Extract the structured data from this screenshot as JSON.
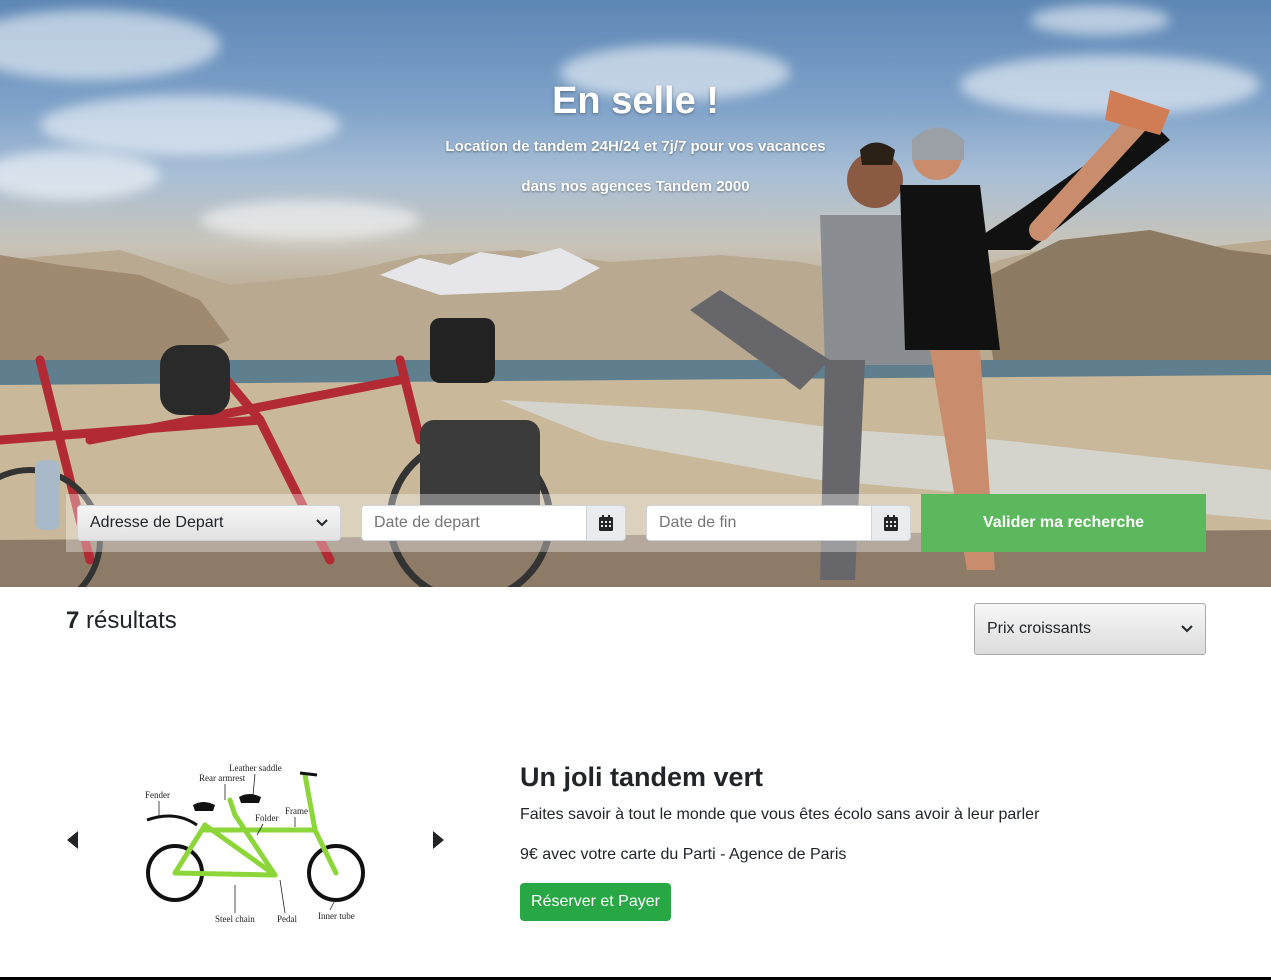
{
  "hero": {
    "title": "En selle !",
    "subtitle_line1": "Location de tandem 24H/24 et 7j/7 pour vos vacances",
    "subtitle_line2": "dans nos agences Tandem 2000"
  },
  "search": {
    "departure_select": "Adresse de Depart",
    "start_date_placeholder": "Date de depart",
    "end_date_placeholder": "Date de fin",
    "submit_label": "Valider ma recherche",
    "submit_color": "#5cb85c"
  },
  "results": {
    "count": "7",
    "label": "résultats",
    "sort_selected": "Prix croissants"
  },
  "product": {
    "title": "Un joli tandem vert",
    "description": "Faites savoir à tout le monde que vous êtes écolo sans avoir à leur parler",
    "price": "9€ avec votre carte du Parti - Agence de Paris",
    "book_label": "Réserver et Payer",
    "book_color": "#28a745",
    "diagram_labels": {
      "leather_saddle": "Leather saddle",
      "rear_armrest": "Rear armrest",
      "fender": "Fender",
      "frame": "Frame",
      "folder": "Folder",
      "steel_chain": "Steel chain",
      "pedal": "Pedal",
      "inner_tube": "Inner tube"
    }
  },
  "icons": {
    "calendar": "calendar-icon",
    "chevron": "chevron-down-icon",
    "prev": "carousel-prev-icon",
    "next": "carousel-next-icon"
  }
}
